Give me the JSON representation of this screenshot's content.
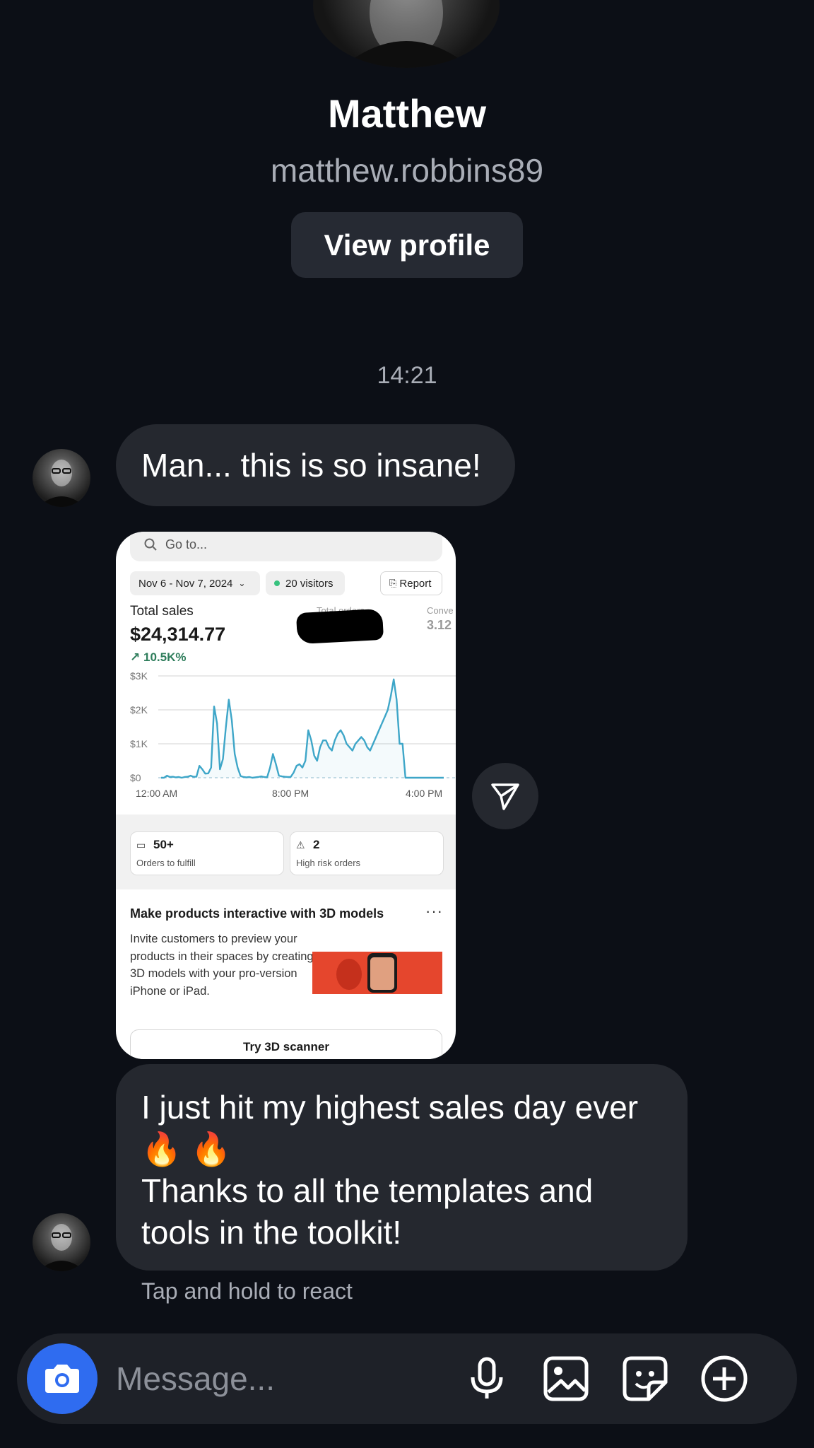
{
  "profile": {
    "name": "Matthew",
    "username": "matthew.robbins89",
    "view_profile_label": "View profile"
  },
  "thread": {
    "timestamp": "14:21",
    "message1": "Man... this is so insane!",
    "message2_line1": "I just hit my highest sales day ever",
    "message2_emoji": "🔥 🔥",
    "message2_line2": "Thanks to all the templates and",
    "message2_line3": "tools in the toolkit!",
    "react_hint": "Tap and hold to react"
  },
  "shared_screenshot": {
    "search_placeholder": "Go to...",
    "date_range": "Nov 6 - Nov 7, 2024",
    "visitors": "20 visitors",
    "report_label": "Report",
    "total_sales_label": "Total sales",
    "total_sales_value": "$24,314.77",
    "growth": "10.5K%",
    "total_orders_label": "Total orders",
    "conversion_label": "Conve",
    "conversion_value": "3.12",
    "orders_to_fulfill_value": "50+",
    "orders_to_fulfill_label": "Orders to fulfill",
    "high_risk_value": "2",
    "high_risk_label": "High risk orders",
    "promo_title": "Make products interactive with 3D models",
    "promo_dots": "···",
    "promo_body": "Invite customers to preview your products in their spaces by creating 3D models with your pro-version iPhone or iPad.",
    "try_button": "Try 3D scanner"
  },
  "chart_data": {
    "type": "line",
    "x_tick_labels": [
      "12:00 AM",
      "8:00 PM",
      "4:00 PM"
    ],
    "y_tick_labels": [
      "$3K",
      "$2K",
      "$1K",
      "$0"
    ],
    "ylim": [
      0,
      3000
    ],
    "x": [
      0,
      2,
      4,
      6,
      8,
      10,
      12,
      14,
      16,
      18,
      20,
      22,
      24,
      26,
      28,
      30,
      32,
      34,
      36,
      38,
      40,
      42,
      44,
      46,
      48,
      50,
      52,
      54,
      56,
      58,
      60,
      62,
      64,
      66,
      68,
      70,
      72,
      74,
      76,
      78,
      80,
      82,
      84,
      86,
      88,
      90,
      92,
      94,
      96,
      98,
      100,
      102,
      104,
      106,
      108,
      110,
      112,
      114,
      116,
      118,
      120,
      122,
      124,
      126,
      128,
      130,
      132,
      134,
      136,
      138,
      140,
      142,
      144,
      146,
      148,
      150,
      152,
      154,
      156,
      158,
      160,
      162,
      164,
      166,
      168,
      170,
      172,
      174,
      176,
      178,
      180,
      182,
      184,
      186,
      188,
      190,
      192
    ],
    "y": [
      0,
      0,
      60,
      20,
      30,
      10,
      20,
      0,
      20,
      30,
      60,
      30,
      30,
      350,
      250,
      120,
      130,
      300,
      2100,
      1600,
      250,
      550,
      1500,
      2300,
      1700,
      700,
      300,
      50,
      20,
      10,
      20,
      0,
      10,
      20,
      40,
      20,
      10,
      300,
      700,
      400,
      60,
      40,
      30,
      20,
      20,
      150,
      350,
      400,
      300,
      500,
      1400,
      1100,
      650,
      500,
      900,
      1100,
      1100,
      900,
      800,
      1100,
      1300,
      1400,
      1250,
      1000,
      900,
      800,
      1000,
      1100,
      1200,
      1100,
      900,
      800,
      1000,
      1200,
      1400,
      1600,
      1800,
      2000,
      2400,
      2900,
      2300,
      1000,
      1000,
      0,
      0,
      0,
      0,
      0,
      0,
      0,
      0,
      0,
      0,
      0,
      0,
      0,
      0
    ],
    "grid": true,
    "series_color": "#3ea6c8",
    "has_baseline_dashed": true
  },
  "composer": {
    "placeholder": "Message...",
    "icons": [
      "camera-icon",
      "microphone-icon",
      "gallery-icon",
      "sticker-icon",
      "plus-circle-icon"
    ]
  },
  "colors": {
    "background": "#0c0f16",
    "bubble": "#25282f",
    "accent": "#2f6cf0",
    "secondary_text": "#a9adb6"
  }
}
